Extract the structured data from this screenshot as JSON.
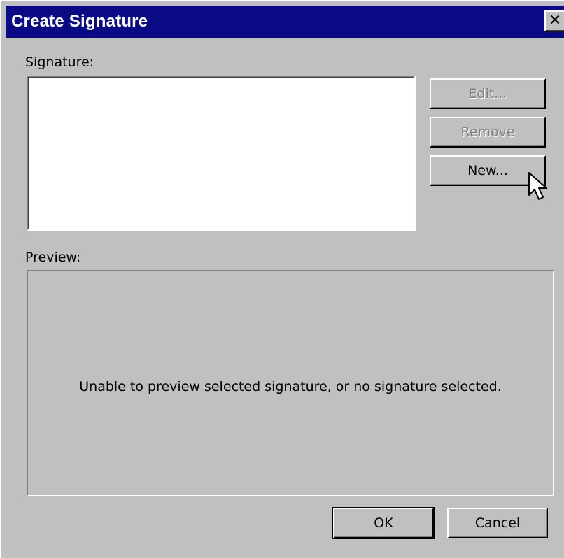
{
  "window": {
    "title": "Create Signature",
    "close_glyph": "✕"
  },
  "signature": {
    "label": "Signature:",
    "items": []
  },
  "buttons": {
    "edit": "Edit...",
    "remove": "Remove",
    "new": "New...",
    "ok": "OK",
    "cancel": "Cancel"
  },
  "preview": {
    "label": "Preview:",
    "message": "Unable to preview selected signature, or no signature selected."
  },
  "colors": {
    "titlebar": "#0a0a84",
    "face": "#c0c0c0",
    "disabled_text": "#808080"
  },
  "icons": {
    "close": "close-icon",
    "cursor": "mouse-pointer-icon"
  }
}
